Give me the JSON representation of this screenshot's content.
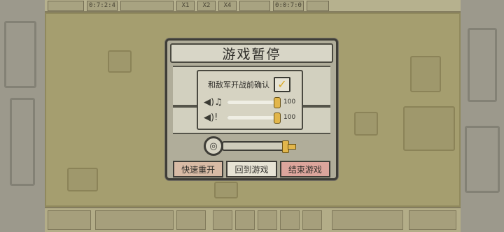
{
  "dialog": {
    "title": "游戏暂停",
    "confirm_label": "和敌军开战前确认",
    "confirm_checked": true,
    "music_volume": 100,
    "music_volume_label": "100",
    "sfx_volume": 100,
    "sfx_volume_label": "100",
    "buttons": {
      "restart": "快速重开",
      "resume": "回到游戏",
      "end": "结束游戏"
    }
  },
  "topbar": {
    "timer": "0:7:2:4",
    "speed_1": "X1",
    "speed_2": "X2",
    "speed_4": "X4",
    "gold": "0:0:7:0"
  },
  "colors": {
    "dialog_bg": "#b0ad9a",
    "knob": "#e2b64b",
    "end_button": "#dca59c",
    "restart_button": "#d8bba5"
  },
  "icons": {
    "music": "music-note-icon",
    "sfx": "speaker-alert-icon",
    "check": "check-icon",
    "scroll": "scroll-wheel-icon"
  }
}
